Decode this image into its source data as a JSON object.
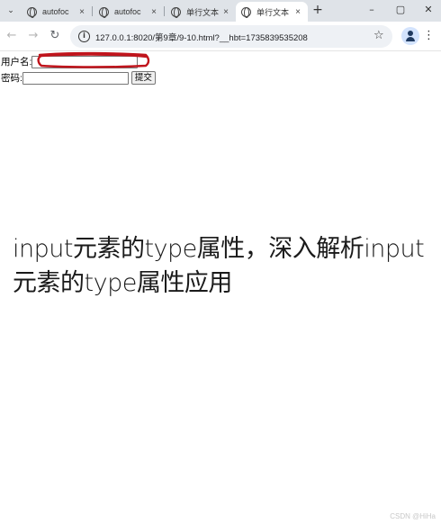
{
  "browser": {
    "tabs": [
      {
        "title": "autofoc",
        "active": false
      },
      {
        "title": "autofoc",
        "active": false
      },
      {
        "title": "单行文本",
        "active": false
      },
      {
        "title": "单行文本",
        "active": true
      }
    ],
    "new_tab_label": "+",
    "close_symbol": "×",
    "window_controls": {
      "minimize": "–",
      "maximize": "▢",
      "close": "✕"
    },
    "url": "127.0.0.1:8020/第9章/9-10.html?__hbt=1735839535208"
  },
  "form": {
    "username_label": "用户名:",
    "username_value": "",
    "password_label": "密码:",
    "password_value": "",
    "submit_label": "提交"
  },
  "annotation": {
    "highlight_color": "#c0141c"
  },
  "overlay": {
    "caption": "input元素的type属性，深入解析input元素的type属性应用",
    "watermark": "CSDN @HiHa"
  },
  "icons": {
    "tab_favicon": "globe-icon",
    "back": "arrow-left-icon",
    "forward": "arrow-right-icon",
    "reload": "reload-icon",
    "site_info": "info-icon",
    "bookmark": "star-icon",
    "profile": "profile-icon",
    "menu": "kebab-menu-icon"
  }
}
